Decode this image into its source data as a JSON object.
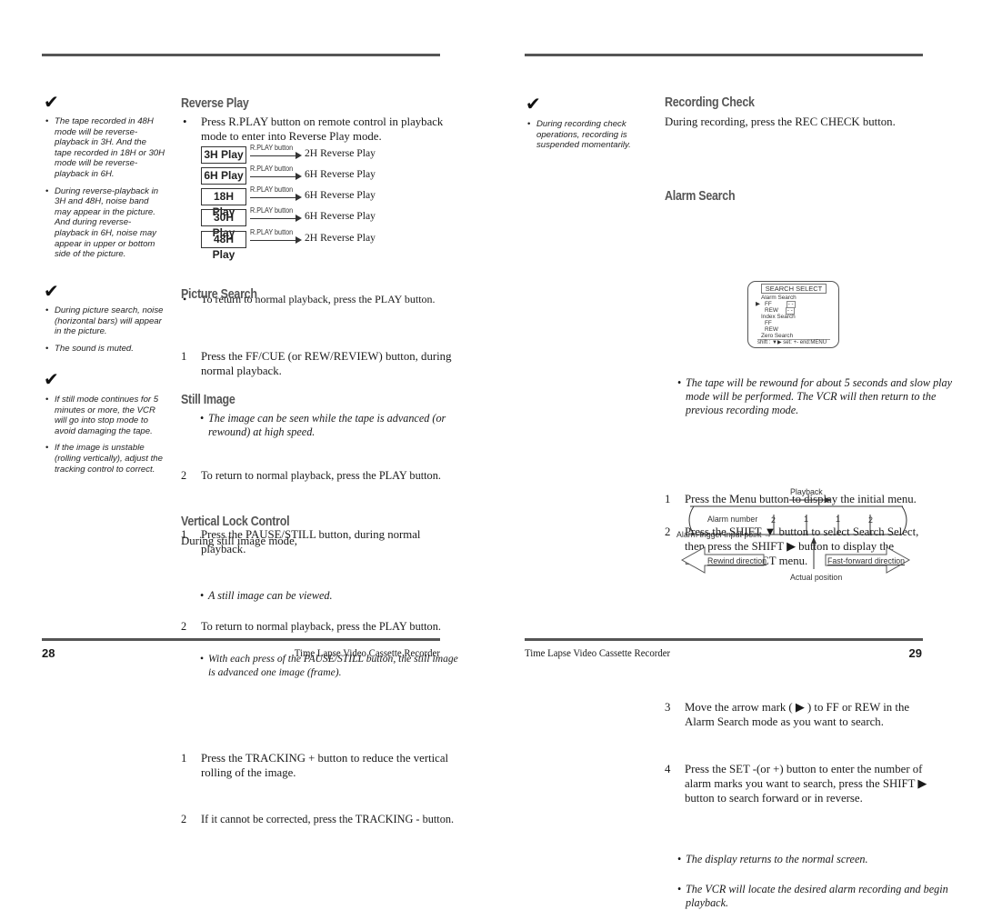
{
  "left_page": {
    "page_number": "28",
    "footer_title": "Time Lapse Video Cassette Recorder",
    "sidebar_notes": [
      {
        "icon": "check-mark-icon",
        "bullets": [
          "The tape recorded in 48H mode will be reverse-playback in 3H. And the tape recorded in 18H or 30H mode will be reverse-playback in 6H.",
          "During reverse-playback in 3H and 48H, noise band may appear in the picture. And during reverse-playback in 6H, noise may appear in upper or bottom side of the picture."
        ]
      },
      {
        "icon": "check-mark-icon",
        "bullets": [
          "During picture search, noise (horizontal bars) will appear in the picture.",
          "The sound is muted."
        ]
      },
      {
        "icon": "check-mark-icon",
        "bullets": [
          "If still mode continues for 5 minutes or more, the VCR will go into stop mode to avoid damaging the tape.",
          "If the image is unstable (rolling vertically), adjust the tracking control to correct."
        ]
      }
    ],
    "reverse_play": {
      "heading": "Reverse Play",
      "intro": "Press R.PLAY button on remote control in playback mode to enter into Reverse Play mode.",
      "button_label": "R.PLAY button",
      "rows": [
        {
          "mode": "3H Play",
          "result": "2H Reverse Play"
        },
        {
          "mode": "6H Play",
          "result": "6H Reverse Play"
        },
        {
          "mode": "18H Play",
          "result": "6H Reverse Play"
        },
        {
          "mode": "30H Play",
          "result": "6H Reverse Play"
        },
        {
          "mode": "48H Play",
          "result": "2H Reverse Play"
        }
      ],
      "outro": "To return to normal playback, press the PLAY button."
    },
    "picture_search": {
      "heading": "Picture Search",
      "step1": "Press the FF/CUE (or REW/REVIEW) button, during normal playback.",
      "note1": "The image can be seen while the tape is advanced (or rewound) at high speed.",
      "step2": "To return to normal playback, press the PLAY button."
    },
    "still_image": {
      "heading": "Still Image",
      "step1": "Press the PAUSE/STILL button, during normal playback.",
      "note1": "A still image can be viewed.",
      "step2": "To return to normal playback, press the PLAY button.",
      "note2": "With each press of the PAUSE/STILL button, the still image is advanced one image (frame)."
    },
    "vertical_lock": {
      "heading": "Vertical Lock Control",
      "intro": "During still image mode,",
      "step1": "Press the TRACKING + button to reduce the vertical rolling of the image.",
      "step2": "If it cannot be corrected, press the TRACKING - button."
    }
  },
  "right_page": {
    "page_number": "29",
    "footer_title": "Time Lapse Video Cassette Recorder",
    "sidebar_note": {
      "icon": "check-mark-icon",
      "bullet": "During recording check operations, recording is suspended momentarily."
    },
    "recording_check": {
      "heading": "Recording Check",
      "intro": "During recording, press the REC CHECK button.",
      "note": "The tape will be rewound for about 5 seconds and slow play mode will be performed. The VCR will then return to the previous recording mode."
    },
    "alarm_search": {
      "heading": "Alarm Search",
      "step1": "Press the Menu button to display the initial menu.",
      "step2_a": "Press the SHIFT",
      "step2_b": "button to select Search Select,",
      "step2_c": "then press the SHIFT",
      "step2_d": "button to display the",
      "step2_e": "SEARCH SELECT menu.",
      "step3_a": "Move the arrow mark (",
      "step3_b": ") to FF or REW in the",
      "step3_c": "Alarm Search mode as you want to search.",
      "step4_a": "Press the SET -(or +) button to enter the number of",
      "step4_b": "alarm marks you want to search, press the SHIFT",
      "step4_c": "button to search forward or in reverse.",
      "note1": "The display returns to the normal screen.",
      "note2": "The VCR will locate the desired alarm recording and begin playback."
    },
    "osd_menu": {
      "title": "SEARCH SELECT",
      "alarm_search": "Alarm Search",
      "ff": "FF",
      "rew": "REW",
      "placeholder": "- -",
      "index_search": "Index Search",
      "index_ff": "FF",
      "index_rew": "REW",
      "zero_search": "Zero Search",
      "footer": "shift : ▼▶ set: +-  end:MENU"
    },
    "diagram": {
      "playback": "Playback",
      "alarm_number_label": "Alarm number",
      "alarm_numbers": [
        "2",
        "1",
        "1",
        "2"
      ],
      "trigger_label": "Alarm trigger input point",
      "rewind": "Rewind direction",
      "fast_forward": "Fast-forward direction",
      "actual_position": "Actual position"
    }
  }
}
